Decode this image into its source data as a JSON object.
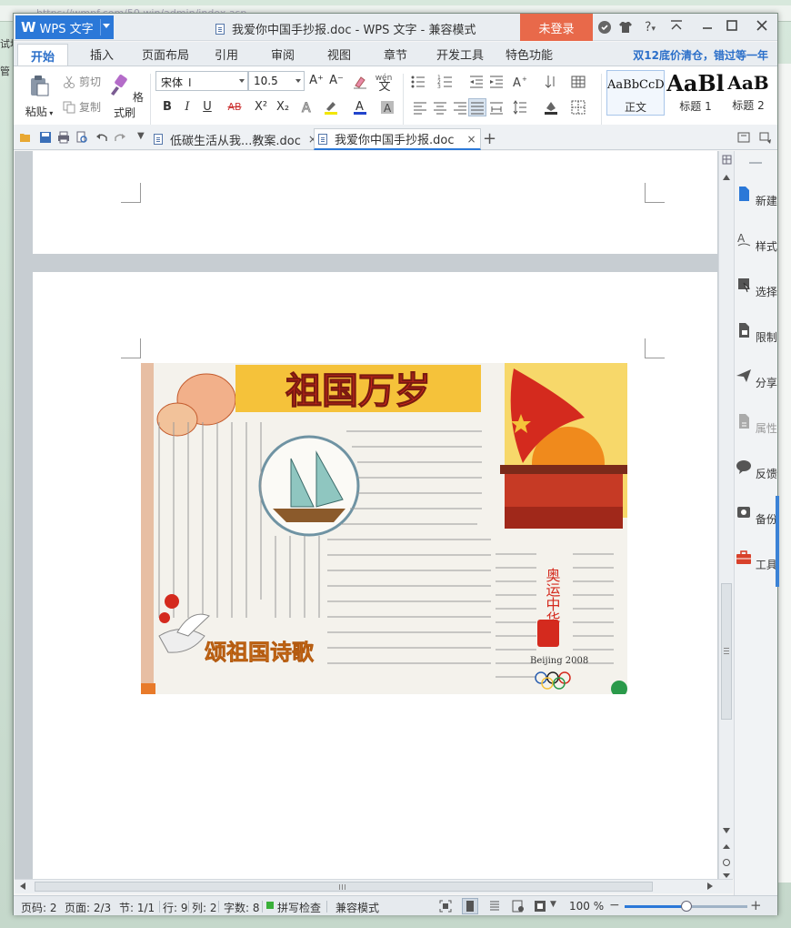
{
  "background": {
    "url_fragment": "https://wmpf.com/50.win/admin/index.asp",
    "left_fragments": [
      "管",
      "试坡"
    ]
  },
  "app": {
    "menu_label": "WPS 文字",
    "window_title": "我爱你中国手抄报.doc - WPS 文字 - 兼容模式",
    "login_label": "未登录",
    "help_label": "?"
  },
  "ribbon_tabs": [
    {
      "label": "开始",
      "active": true
    },
    {
      "label": "插入"
    },
    {
      "label": "页面布局"
    },
    {
      "label": "引用"
    },
    {
      "label": "审阅"
    },
    {
      "label": "视图"
    },
    {
      "label": "章节"
    },
    {
      "label": "开发工具"
    },
    {
      "label": "特色功能"
    }
  ],
  "promo_text": "双12底价清仓，错过等一年",
  "ribbon": {
    "paste": "粘贴",
    "cut": "剪切",
    "copy": "复制",
    "format_painter": "格式刷",
    "font_name": "宋体",
    "font_size": "10.5",
    "font_grow": "A⁺",
    "font_shrink": "A⁻",
    "wen": "wén",
    "bold": "B",
    "italic": "I",
    "underline": "U",
    "strike": "AB",
    "superscript": "X²",
    "subscript": "X₂",
    "styles": [
      {
        "sample": "AaBbCcD",
        "label": "正文",
        "size": 13,
        "selected": true
      },
      {
        "sample": "AaBl",
        "label": "标题 1",
        "size": 24
      },
      {
        "sample": "AaB",
        "label": "标题 2",
        "size": 20
      }
    ]
  },
  "doc_tabs": [
    {
      "label": "低碳生活从我...教案.doc",
      "close": "×"
    },
    {
      "label": "我爱你中国手抄报.doc",
      "close": "×",
      "active": true
    }
  ],
  "side_panel": [
    {
      "icon": "new-doc-icon",
      "label": "新建"
    },
    {
      "icon": "style-icon",
      "label": "样式"
    },
    {
      "icon": "select-icon",
      "label": "选择"
    },
    {
      "icon": "restrict-icon",
      "label": "限制"
    },
    {
      "icon": "share-icon",
      "label": "分享"
    },
    {
      "icon": "properties-icon",
      "label": "属性",
      "dim": true
    },
    {
      "icon": "feedback-icon",
      "label": "反馈"
    },
    {
      "icon": "backup-icon",
      "label": "备份"
    },
    {
      "icon": "toolbox-icon",
      "label": "工具"
    }
  ],
  "poster": {
    "title_top": "祖国万岁",
    "title_bottom": "颂祖国诗歌",
    "side_text": "奥运中华",
    "olympic": "Beijing 2008",
    "colors": {
      "red": "#d42a1e",
      "orange": "#f08a1c",
      "yellow": "#f5c23a",
      "paper": "#f4f2ec",
      "ink": "#3a3a3a"
    }
  },
  "status": {
    "page_code": "页码: 2",
    "pages": "页面: 2/3",
    "section": "节: 1/1",
    "row": "行: 9",
    "col": "列: 2",
    "words": "字数: 8",
    "spell": "拼写检查",
    "compat": "兼容模式",
    "zoom": "100 %",
    "zoom_level": 0.5
  }
}
